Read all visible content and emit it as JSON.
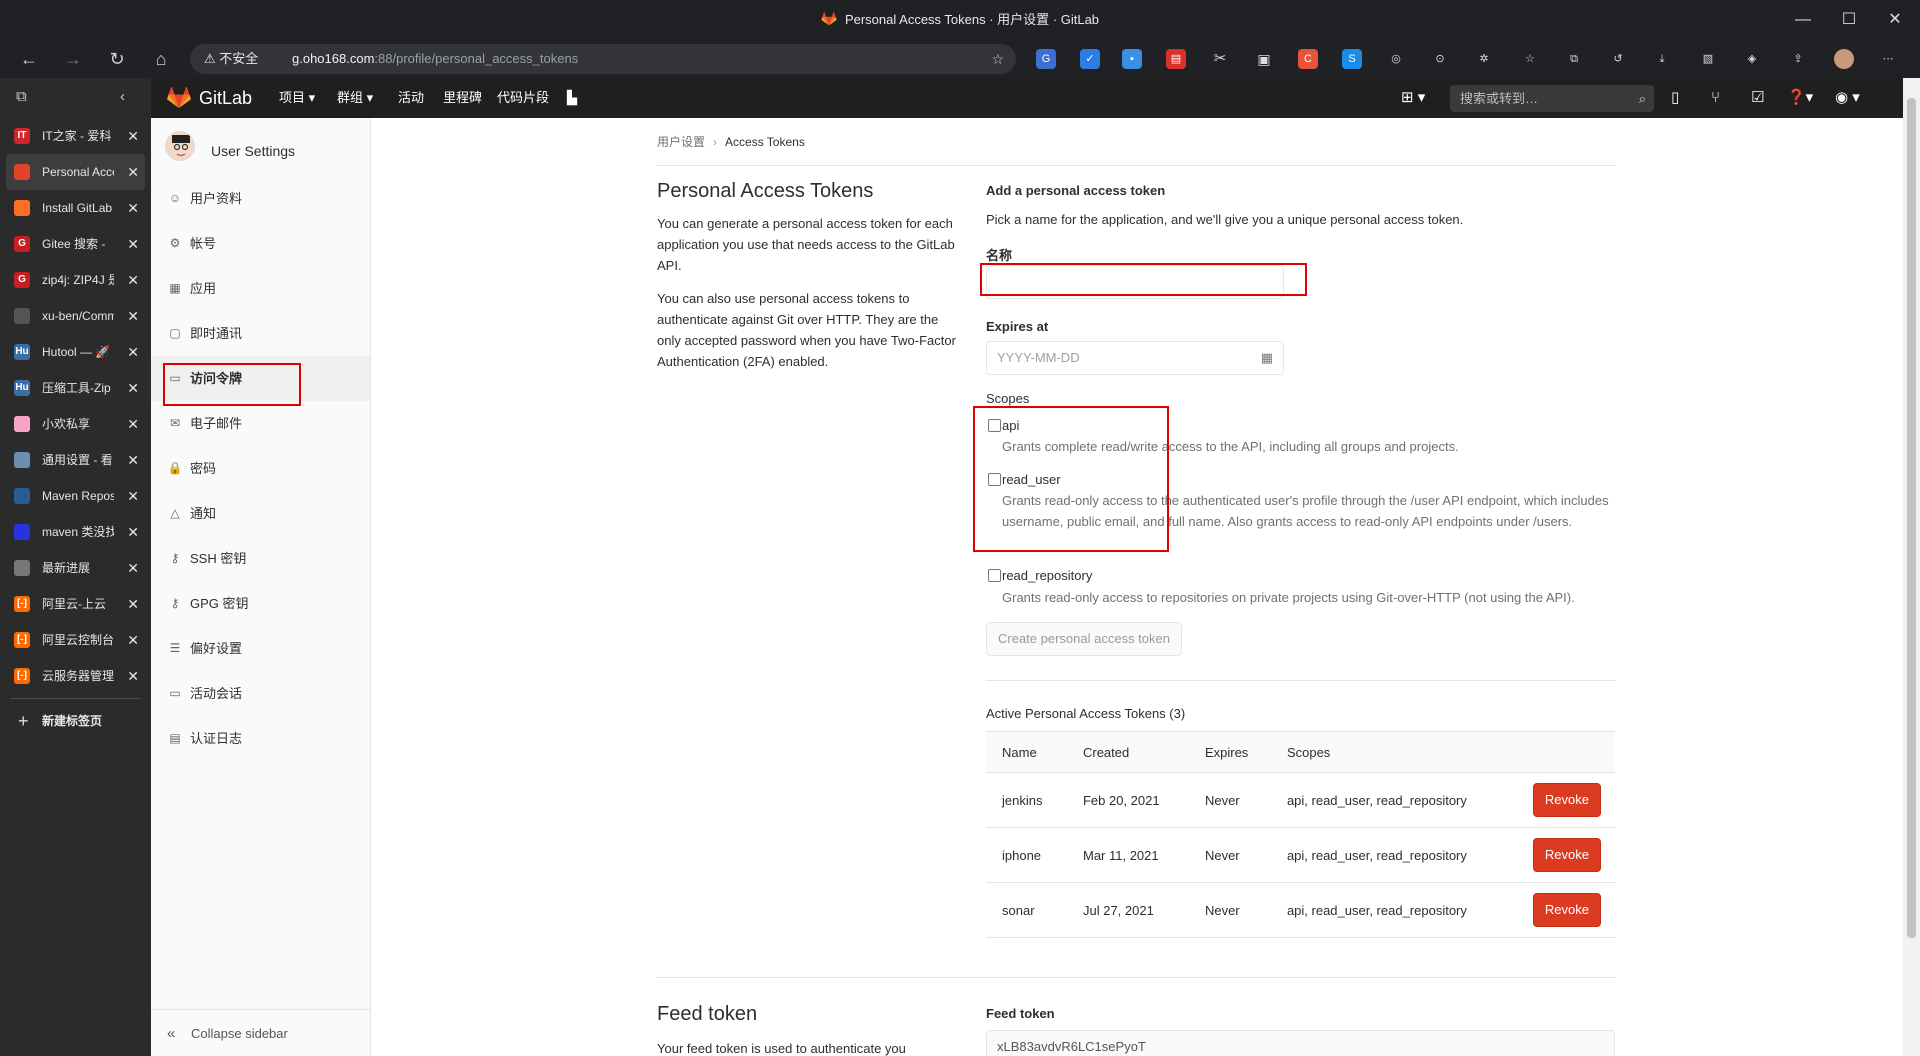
{
  "browser": {
    "window_title": "Personal Access Tokens · 用户设置 · GitLab",
    "security_label": "不安全",
    "url_host": "g.oho168.com",
    "url_rest": ":88/profile/personal_access_tokens"
  },
  "tabs": [
    {
      "label": "IT之家 - 爱科",
      "icon_text": "IT",
      "icon_color": "#d3232b"
    },
    {
      "label": "Personal Access",
      "icon_text": "",
      "icon_color": "#e24329"
    },
    {
      "label": "Install GitLab",
      "icon_text": "",
      "icon_color": "#fc6d26"
    },
    {
      "label": "Gitee 搜索 - ",
      "icon_text": "G",
      "icon_color": "#c71d23"
    },
    {
      "label": "zip4j: ZIP4J 是",
      "icon_text": "G",
      "icon_color": "#c71d23"
    },
    {
      "label": "xu-ben/Comm",
      "icon_text": "",
      "icon_color": "#555555"
    },
    {
      "label": "Hutool — 🚀",
      "icon_text": "Hu",
      "icon_color": "#3a6ea5"
    },
    {
      "label": "压缩工具-Zip",
      "icon_text": "Hu",
      "icon_color": "#3a6ea5"
    },
    {
      "label": "小欢私享",
      "icon_text": "",
      "icon_color": "#f7a5c4"
    },
    {
      "label": "通用设置 - 看",
      "icon_text": "",
      "icon_color": "#6b8fb0"
    },
    {
      "label": "Maven Reposi",
      "icon_text": "",
      "icon_color": "#2a5d8f"
    },
    {
      "label": "maven 类没找",
      "icon_text": "",
      "icon_color": "#2932e1"
    },
    {
      "label": "最新进展",
      "icon_text": "",
      "icon_color": "#777777"
    },
    {
      "label": "阿里云-上云",
      "icon_text": "[-]",
      "icon_color": "#ff6a00"
    },
    {
      "label": "阿里云控制台",
      "icon_text": "[-]",
      "icon_color": "#ff6a00"
    },
    {
      "label": "云服务器管理",
      "icon_text": "[-]",
      "icon_color": "#ff6a00"
    }
  ],
  "new_tab_label": "新建标签页",
  "gitlab": {
    "brand": "GitLab",
    "nav": [
      "项目",
      "群组",
      "活动",
      "里程碑",
      "代码片段"
    ],
    "search_placeholder": "搜索或转到…"
  },
  "sidebar": {
    "context_title": "User Settings",
    "items": [
      {
        "label": "用户资料",
        "icon": "profile-icon",
        "glyph": "☺"
      },
      {
        "label": "帐号",
        "icon": "account-icon",
        "glyph": "⚙"
      },
      {
        "label": "应用",
        "icon": "applications-icon",
        "glyph": "▦"
      },
      {
        "label": "即时通讯",
        "icon": "chat-icon",
        "glyph": "▢"
      },
      {
        "label": "访问令牌",
        "icon": "access-token-icon",
        "glyph": "▭"
      },
      {
        "label": "电子邮件",
        "icon": "email-icon",
        "glyph": "✉"
      },
      {
        "label": "密码",
        "icon": "lock-icon",
        "glyph": "🔒"
      },
      {
        "label": "通知",
        "icon": "notification-icon",
        "glyph": "△"
      },
      {
        "label": "SSH 密钥",
        "icon": "key-icon",
        "glyph": "⚷"
      },
      {
        "label": "GPG 密钥",
        "icon": "key-icon",
        "glyph": "⚷"
      },
      {
        "label": "偏好设置",
        "icon": "preferences-icon",
        "glyph": "☰"
      },
      {
        "label": "活动会话",
        "icon": "sessions-icon",
        "glyph": "▭"
      },
      {
        "label": "认证日志",
        "icon": "log-icon",
        "glyph": "▤"
      }
    ],
    "collapse_label": "Collapse sidebar"
  },
  "breadcrumb": {
    "parent": "用户设置",
    "current": "Access Tokens"
  },
  "intro": {
    "title": "Personal Access Tokens",
    "p1": "You can generate a personal access token for each application you use that needs access to the GitLab API.",
    "p2": "You can also use personal access tokens to authenticate against Git over HTTP. They are the only accepted password when you have Two-Factor Authentication (2FA) enabled."
  },
  "form": {
    "heading": "Add a personal access token",
    "subtitle": "Pick a name for the application, and we'll give you a unique personal access token.",
    "name_label": "名称",
    "name_value": "",
    "expires_label": "Expires at",
    "expires_placeholder": "YYYY-MM-DD",
    "scopes_label": "Scopes",
    "scopes": [
      {
        "name": "api",
        "desc": "Grants complete read/write access to the API, including all groups and projects.",
        "checked": false
      },
      {
        "name": "read_user",
        "desc": "Grants read-only access to the authenticated user's profile through the /user API endpoint, which includes username, public email, and full name. Also grants access to read-only API endpoints under /users.",
        "checked": false
      },
      {
        "name": "read_repository",
        "desc": "Grants read-only access to repositories on private projects using Git-over-HTTP (not using the API).",
        "checked": false
      }
    ],
    "create_button": "Create personal access token"
  },
  "active_tokens": {
    "heading": "Active Personal Access Tokens (3)",
    "columns": [
      "Name",
      "Created",
      "Expires",
      "Scopes"
    ],
    "rows": [
      {
        "name": "jenkins",
        "created": "Feb 20, 2021",
        "expires": "Never",
        "scopes": "api, read_user, read_repository"
      },
      {
        "name": "iphone",
        "created": "Mar 11, 2021",
        "expires": "Never",
        "scopes": "api, read_user, read_repository"
      },
      {
        "name": "sonar",
        "created": "Jul 27, 2021",
        "expires": "Never",
        "scopes": "api, read_user, read_repository"
      }
    ],
    "revoke_label": "Revoke"
  },
  "feed": {
    "title": "Feed token",
    "desc": "Your feed token is used to authenticate you",
    "label": "Feed token",
    "value": "xLB83avdvR6LC1sePyoT"
  },
  "colors": {
    "accent": "#e24329",
    "revoke": "#db3b21",
    "highlight": "#e00000"
  }
}
